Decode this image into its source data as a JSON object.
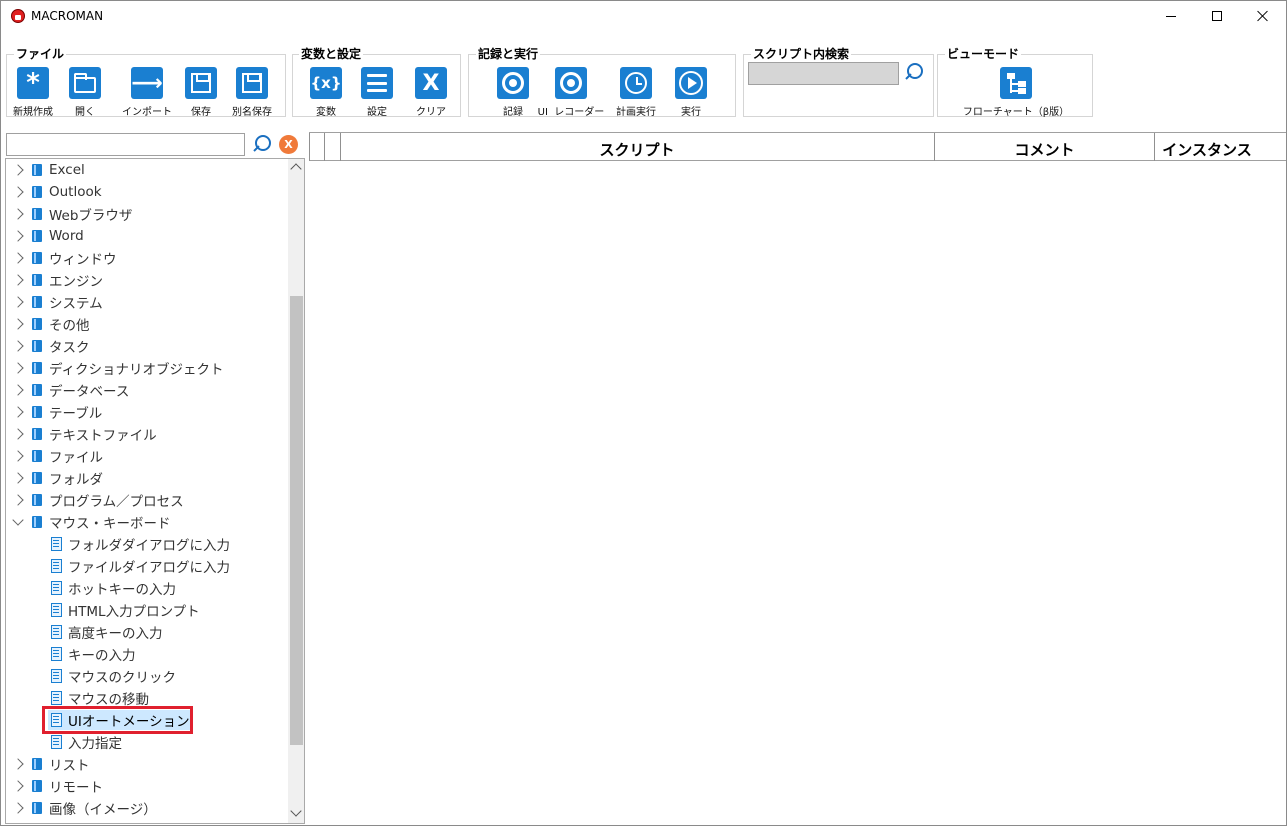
{
  "window": {
    "title": "MACROMAN"
  },
  "ribbon": {
    "groups": {
      "file": {
        "title": "ファイル",
        "buttons": [
          {
            "label": "新規作成",
            "icon": "new-asterisk-icon"
          },
          {
            "label": "開く",
            "icon": "open-folder-icon"
          },
          {
            "label": "インポート",
            "icon": "import-arrow-icon"
          },
          {
            "label": "保存",
            "icon": "save-disk-icon"
          },
          {
            "label": "別名保存",
            "icon": "save-as-disk-icon"
          }
        ]
      },
      "vars": {
        "title": "変数と設定",
        "buttons": [
          {
            "label": "変数",
            "glyph": "{x}",
            "icon": "variable-icon"
          },
          {
            "label": "設定",
            "icon": "settings-list-icon"
          },
          {
            "label": "クリア",
            "glyph": "X",
            "icon": "clear-x-icon"
          }
        ]
      },
      "record": {
        "title": "記録と実行",
        "buttons": [
          {
            "label": "記録",
            "icon": "record-icon"
          },
          {
            "label": "UI  レコーダー",
            "icon": "ui-recorder-icon"
          },
          {
            "label": "計画実行",
            "icon": "schedule-clock-icon"
          },
          {
            "label": "実行",
            "icon": "play-icon"
          }
        ]
      },
      "search": {
        "title": "スクリプト内検索",
        "value": ""
      },
      "view": {
        "title": "ビューモード",
        "buttons": [
          {
            "label": "フローチャート（β版）",
            "icon": "flowchart-icon"
          }
        ]
      }
    }
  },
  "tree": {
    "search_value": "",
    "clear_glyph": "X",
    "items": [
      {
        "label": "Excel"
      },
      {
        "label": "Outlook"
      },
      {
        "label": "Webブラウザ"
      },
      {
        "label": "Word"
      },
      {
        "label": "ウィンドウ"
      },
      {
        "label": "エンジン"
      },
      {
        "label": "システム"
      },
      {
        "label": "その他"
      },
      {
        "label": "タスク"
      },
      {
        "label": "ディクショナリオブジェクト"
      },
      {
        "label": "データベース"
      },
      {
        "label": "テーブル"
      },
      {
        "label": "テキストファイル"
      },
      {
        "label": "ファイル"
      },
      {
        "label": "フォルダ"
      },
      {
        "label": "プログラム／プロセス"
      },
      {
        "label": "マウス・キーボード"
      },
      {
        "label": "フォルダダイアログに入力"
      },
      {
        "label": "ファイルダイアログに入力"
      },
      {
        "label": "ホットキーの入力"
      },
      {
        "label": "HTML入力プロンプト"
      },
      {
        "label": "高度キーの入力"
      },
      {
        "label": "キーの入力"
      },
      {
        "label": "マウスのクリック"
      },
      {
        "label": "マウスの移動"
      },
      {
        "label": "UIオートメーション"
      },
      {
        "label": "入力指定"
      },
      {
        "label": "リスト"
      },
      {
        "label": "リモート"
      },
      {
        "label": "画像（イメージ）"
      }
    ]
  },
  "grid": {
    "columns": [
      "スクリプト",
      "コメント",
      "インスタンス"
    ]
  },
  "colors": {
    "accent": "#1a7fd1",
    "highlight": "#e0202e",
    "clear_button": "#f07a3a"
  }
}
